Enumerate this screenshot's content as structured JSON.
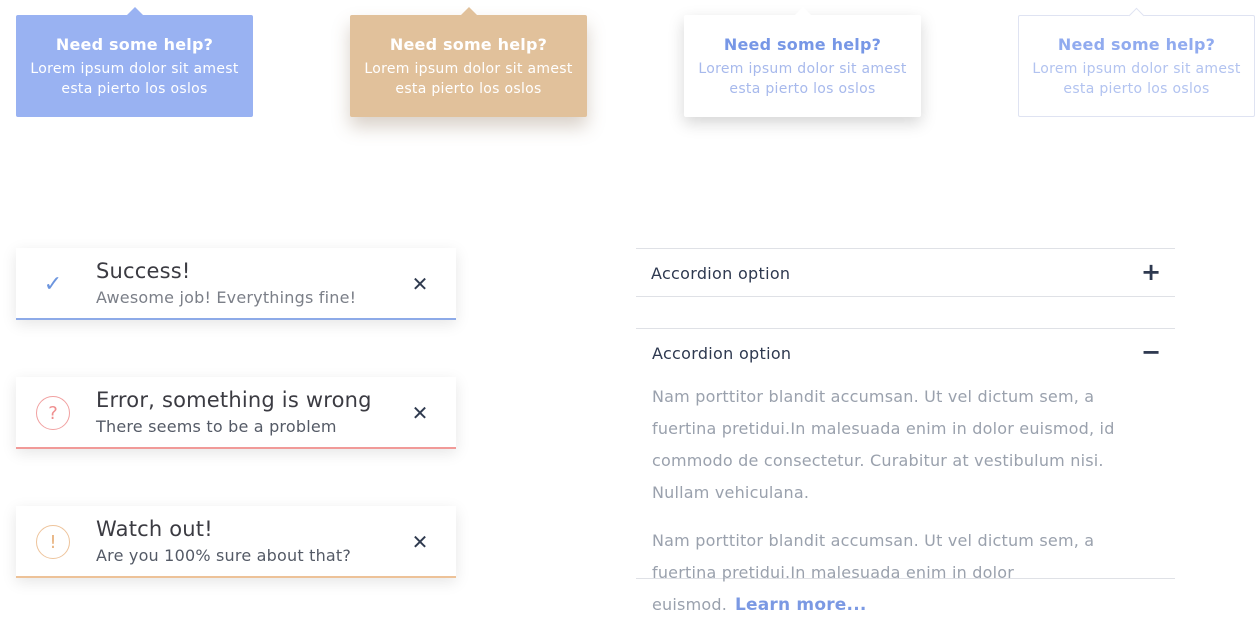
{
  "tooltips": [
    {
      "variant": "blue-filled",
      "title": "Need some help?",
      "body": "Lorem ipsum dolor sit amest esta pierto los oslos"
    },
    {
      "variant": "tan-filled-shadow",
      "title": "Need some help?",
      "body": "Lorem ipsum dolor sit amest esta pierto los oslos"
    },
    {
      "variant": "white-shadow",
      "title": "Need some help?",
      "body": "Lorem ipsum dolor sit amest esta pierto los oslos"
    },
    {
      "variant": "white-outline",
      "title": "Need some help?",
      "body": "Lorem ipsum dolor sit amest esta pierto los oslos"
    }
  ],
  "alerts": [
    {
      "type": "success",
      "icon": "check-icon",
      "icon_glyph": "✓",
      "title": "Success!",
      "message": "Awesome job! Everythings fine!",
      "close_glyph": "✕",
      "color": "#8daae8"
    },
    {
      "type": "error",
      "icon": "question-circle-icon",
      "icon_glyph": "?",
      "title": "Error, something is wrong",
      "message": "There seems to be a problem",
      "close_glyph": "✕",
      "color": "#f19a98"
    },
    {
      "type": "warning",
      "icon": "exclamation-circle-icon",
      "icon_glyph": "!",
      "title": "Watch out!",
      "message": "Are you 100% sure about that?",
      "close_glyph": "✕",
      "color": "#edc298"
    }
  ],
  "accordion": [
    {
      "label": "Accordion option",
      "expanded": false,
      "toggle_glyph": "+"
    },
    {
      "label": "Accordion option",
      "expanded": true,
      "toggle_glyph": "−",
      "paragraphs": [
        "Nam porttitor blandit accumsan. Ut vel dictum sem, a fuertina pretidui.In malesuada enim in dolor euismod, id commodo de consectetur. Curabitur at vestibulum nisi. Nullam vehiculana.",
        "Nam porttitor blandit accumsan. Ut vel dictum sem, a fuertina pretidui.In malesuada enim in dolor euismod."
      ],
      "link_label": "Learn more..."
    }
  ],
  "colors": {
    "blue": "#99b2f2",
    "tan": "#e1c19b",
    "accent_text": "#7797e6",
    "success": "#8daae8",
    "error": "#f19a98",
    "warning": "#edc298"
  }
}
